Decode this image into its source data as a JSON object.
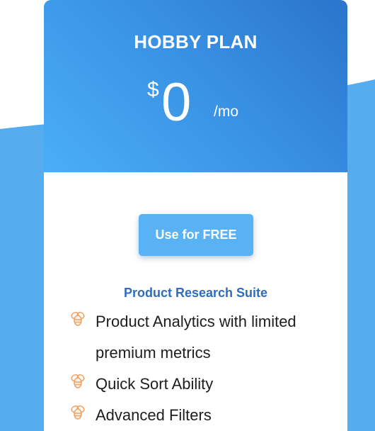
{
  "plan": {
    "name": "HOBBY PLAN",
    "currency": "$",
    "amount": "0",
    "period": "/mo"
  },
  "cta": {
    "label": "Use for FREE"
  },
  "suite": {
    "title": "Product Research Suite"
  },
  "features": [
    {
      "label": "Product Analytics with limited premium metrics",
      "icon": "bee-icon"
    },
    {
      "label": "Quick Sort Ability",
      "icon": "bee-icon"
    },
    {
      "label": "Advanced Filters",
      "icon": "bee-icon"
    }
  ],
  "colors": {
    "header_gradient_start": "#2a74cc",
    "header_gradient_end": "#4aaef7",
    "button": "#58b2f3",
    "suite_title": "#2f6bbf",
    "icon": "#f0a060"
  }
}
